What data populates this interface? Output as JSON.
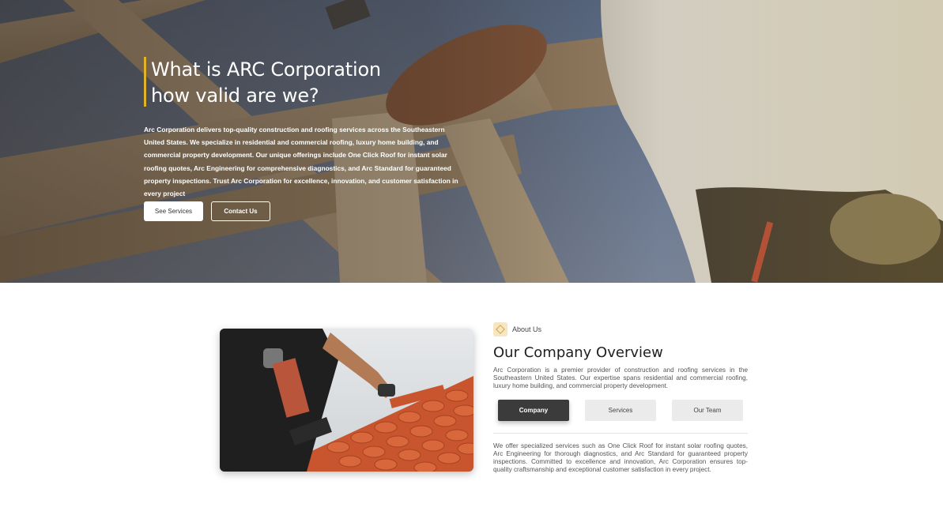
{
  "hero": {
    "title_line1": "What is ARC Corporation",
    "title_line2": "how valid are we?",
    "description": "Arc Corporation delivers top-quality construction and roofing services across the Southeastern United States. We specialize in residential and commercial roofing, luxury home building, and commercial property development. Our unique offerings include One Click Roof for instant solar roofing quotes, Arc Engineering for comprehensive diagnostics, and Arc Standard for guaranteed property inspections. Trust Arc Corporation for excellence, innovation, and customer satisfaction in every project",
    "buttons": {
      "see_services": "See Services",
      "contact_us": "Contact Us"
    }
  },
  "about": {
    "tag_icon": "diamond-icon",
    "tag_label": "About Us",
    "title": "Our Company Overview",
    "paragraph1": "Arc Corporation is a premier provider of construction and roofing services in the Southeastern United States. Our expertise spans residential and commercial roofing, luxury home building, and commercial property development.",
    "tabs": [
      {
        "label": "Company",
        "active": true
      },
      {
        "label": "Services",
        "active": false
      },
      {
        "label": "Our Team",
        "active": false
      }
    ],
    "paragraph2": "We offer specialized services such as One Click Roof for instant solar roofing quotes, Arc Engineering for thorough diagnostics, and Arc Standard for guaranteed property inspections. Committed to excellence and innovation, Arc Corporation ensures top-quality craftsmanship and exceptional customer satisfaction in every project."
  },
  "colors": {
    "accent": "#e2b227",
    "dark_tab": "#3b3b3b",
    "tile": "#c8552e"
  }
}
